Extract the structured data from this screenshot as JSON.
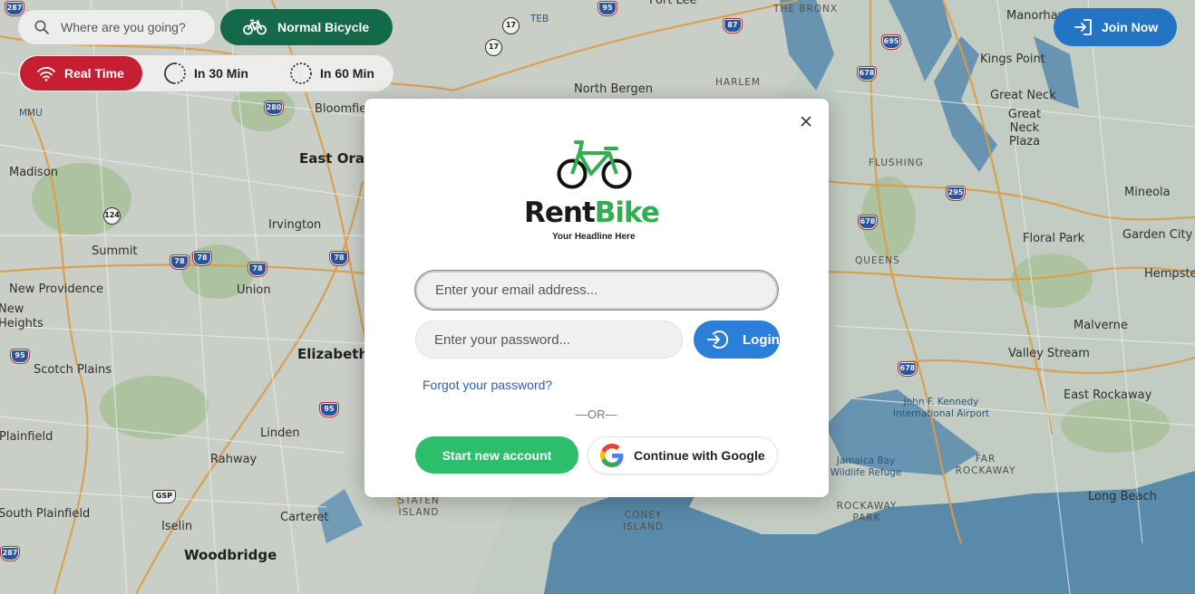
{
  "search": {
    "placeholder": "Where are you going?"
  },
  "bike_type": {
    "label": "Normal Bicycle"
  },
  "time_options": [
    {
      "label": "Real Time",
      "active": true
    },
    {
      "label": "In 30 Min",
      "active": false
    },
    {
      "label": "In 60 Min",
      "active": false
    }
  ],
  "header": {
    "join_label": "Join Now"
  },
  "modal": {
    "brand_rent": "Rent",
    "brand_bike": "Bike",
    "tagline": "Your Headline Here",
    "email_placeholder": "Enter your email address...",
    "password_placeholder": "Enter your password...",
    "login_label": "Login",
    "forgot_label": "Forgot your password?",
    "or_label": "—OR—",
    "signup_label": "Start new account",
    "google_label": "Continue with Google"
  },
  "colors": {
    "accent_red": "#c61f32",
    "accent_green": "#14694a",
    "join_blue": "#2474c6",
    "login_blue": "#2a80d9",
    "signup_green": "#2dbe6c",
    "brand_green": "#2fae52"
  },
  "map": {
    "places": [
      {
        "name": "Madison",
        "cls": ""
      },
      {
        "name": "Summit",
        "cls": ""
      },
      {
        "name": "New Providence",
        "cls": ""
      },
      {
        "name": "Scotch Plains",
        "cls": ""
      },
      {
        "name": "Plainfield",
        "cls": ""
      },
      {
        "name": "South Plainfield",
        "cls": ""
      },
      {
        "name": "Irvington",
        "cls": ""
      },
      {
        "name": "Union",
        "cls": ""
      },
      {
        "name": "Elizabeth",
        "cls": "big"
      },
      {
        "name": "East Orange",
        "cls": "big"
      },
      {
        "name": "Bloomfield",
        "cls": ""
      },
      {
        "name": "Linden",
        "cls": ""
      },
      {
        "name": "Rahway",
        "cls": ""
      },
      {
        "name": "Carteret",
        "cls": ""
      },
      {
        "name": "Iselin",
        "cls": ""
      },
      {
        "name": "Woodbridge",
        "cls": "big"
      },
      {
        "name": "North Bergen",
        "cls": ""
      },
      {
        "name": "Kings Point",
        "cls": ""
      },
      {
        "name": "Great Neck",
        "cls": ""
      },
      {
        "name": "Great Neck Plaza",
        "cls": ""
      },
      {
        "name": "Mineola",
        "cls": ""
      },
      {
        "name": "Garden City",
        "cls": ""
      },
      {
        "name": "Floral Park",
        "cls": ""
      },
      {
        "name": "Hempstead",
        "cls": ""
      },
      {
        "name": "Malverne",
        "cls": ""
      },
      {
        "name": "Valley Stream",
        "cls": ""
      },
      {
        "name": "East Rockaway",
        "cls": ""
      },
      {
        "name": "Long Beach",
        "cls": ""
      },
      {
        "name": "Manorhaven",
        "cls": ""
      },
      {
        "name": "QUEENS",
        "cls": "area"
      },
      {
        "name": "FLUSHING",
        "cls": "area"
      },
      {
        "name": "THE BRONX",
        "cls": "area"
      },
      {
        "name": "HARLEM",
        "cls": "area"
      },
      {
        "name": "STATEN ISLAND",
        "cls": "area"
      },
      {
        "name": "CONEY ISLAND",
        "cls": "area"
      },
      {
        "name": "FAR ROCKAWAY",
        "cls": "area"
      },
      {
        "name": "ROCKAWAY PARK",
        "cls": "area"
      },
      {
        "name": "John F. Kennedy International Airport",
        "cls": "water"
      },
      {
        "name": "Jamaica Bay Wildlife Refuge",
        "cls": "water"
      },
      {
        "name": "New Heights",
        "cls": ""
      },
      {
        "name": "Fort Lee",
        "cls": ""
      },
      {
        "name": "MMU",
        "cls": "water"
      },
      {
        "name": "TEB",
        "cls": "water"
      }
    ],
    "shields": [
      "287",
      "280",
      "78",
      "78",
      "78",
      "78",
      "95",
      "17",
      "17",
      "124",
      "95",
      "87",
      "678",
      "678",
      "678",
      "295",
      "95",
      "287",
      "GSP",
      "695"
    ]
  }
}
